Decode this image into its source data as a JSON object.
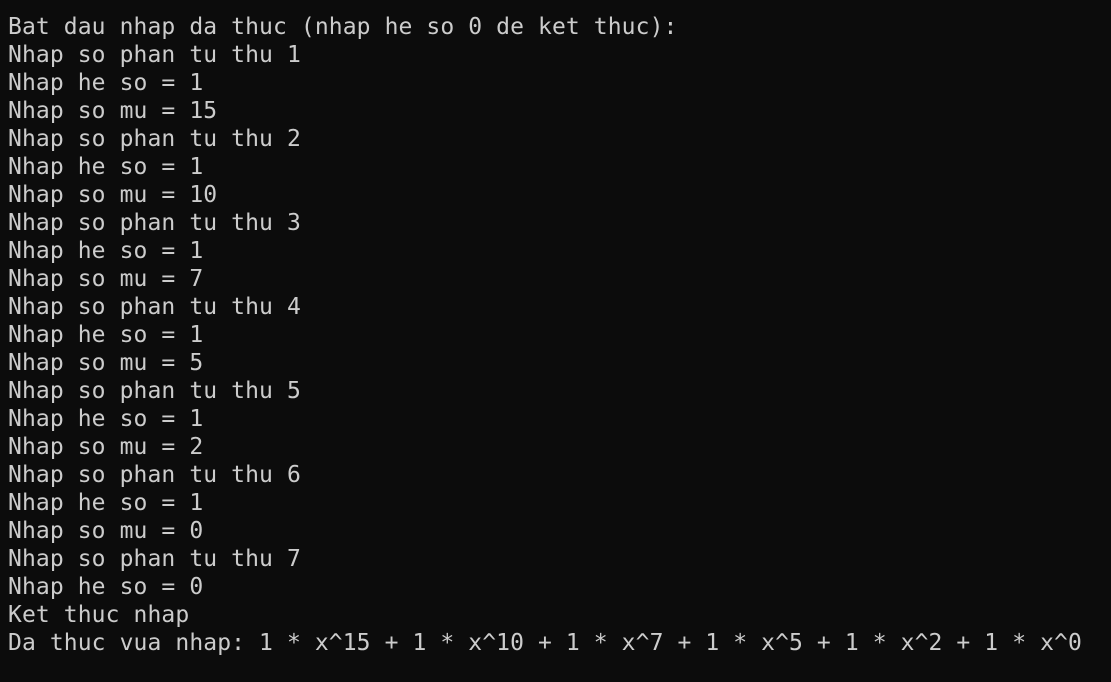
{
  "terminal": {
    "lines": [
      "Bat dau nhap da thuc (nhap he so 0 de ket thuc):",
      "Nhap so phan tu thu 1",
      "Nhap he so = 1",
      "Nhap so mu = 15",
      "Nhap so phan tu thu 2",
      "Nhap he so = 1",
      "Nhap so mu = 10",
      "Nhap so phan tu thu 3",
      "Nhap he so = 1",
      "Nhap so mu = 7",
      "Nhap so phan tu thu 4",
      "Nhap he so = 1",
      "Nhap so mu = 5",
      "Nhap so phan tu thu 5",
      "Nhap he so = 1",
      "Nhap so mu = 2",
      "Nhap so phan tu thu 6",
      "Nhap he so = 1",
      "Nhap so mu = 0",
      "Nhap so phan tu thu 7",
      "Nhap he so = 0",
      "Ket thuc nhap",
      "Da thuc vua nhap: 1 * x^15 + 1 * x^10 + 1 * x^7 + 1 * x^5 + 1 * x^2 + 1 * x^0"
    ]
  },
  "colors": {
    "background": "#0c0c0c",
    "text": "#cccccc"
  }
}
